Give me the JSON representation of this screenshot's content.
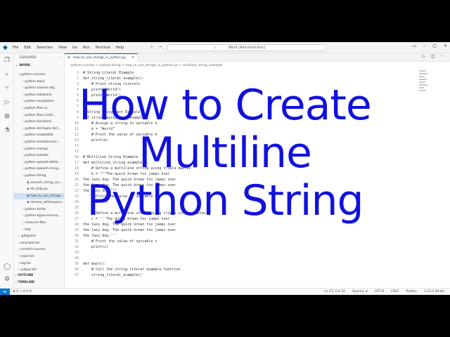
{
  "titlebar": {
    "menu": [
      "File",
      "Edit",
      "Selection",
      "View",
      "Go",
      "Run",
      "Terminal",
      "Help"
    ],
    "search_placeholder": "Work [Administrator]"
  },
  "sidebar": {
    "header": "EXPLORER",
    "section_work": "WORK",
    "tree": [
      {
        "label": "python-courses",
        "indent": 1
      },
      {
        "label": "python-basic",
        "indent": 2
      },
      {
        "label": "python-classes-obj...",
        "indent": 2
      },
      {
        "label": "python-database",
        "indent": 2
      },
      {
        "label": "python-exceptions",
        "indent": 2
      },
      {
        "label": "python-files-io",
        "indent": 2
      },
      {
        "label": "python-flow-contr...",
        "indent": 2
      },
      {
        "label": "python-functions",
        "indent": 2
      },
      {
        "label": "python-list-tuple-dict...",
        "indent": 2
      },
      {
        "label": "python-matplotlib",
        "indent": 2
      },
      {
        "label": "python-modules-pac...",
        "indent": 2
      },
      {
        "label": "python-numpy",
        "indent": 2
      },
      {
        "label": "python-pandas",
        "indent": 2
      },
      {
        "label": "python-special-attrib...",
        "indent": 2
      },
      {
        "label": "python-speech-recog...",
        "indent": 2
      },
      {
        "label": "python-string",
        "indent": 2
      },
      {
        "label": "convert_string_csv...",
        "indent": 3
      },
      {
        "label": "dir_help.py",
        "indent": 3
      },
      {
        "label": "how_to_use_strings...",
        "indent": 3
      },
      {
        "label": "remove_whitespace...",
        "indent": 3
      },
      {
        "label": "python-turtle",
        "indent": 2
      },
      {
        "label": "python-typos-and-op...",
        "indent": 2
      },
      {
        "label": "resource-files",
        "indent": 2
      },
      {
        "label": "test",
        "indent": 2
      },
      {
        "label": ".gitignore",
        "indent": 1
      },
      {
        "label": "example.txt",
        "indent": 1
      },
      {
        "label": "scratch-courses",
        "indent": 1
      },
      {
        "label": "input.txt",
        "indent": 1
      },
      {
        "label": "log.txt",
        "indent": 1
      },
      {
        "label": "output.txt",
        "indent": 1
      }
    ],
    "selected_index": 18,
    "section_outline": "OUTLINE",
    "section_timeline": "TIMELINE"
  },
  "editor": {
    "tab_label": "how_to_use_strings_in_python.py",
    "breadcrumb": "python-courses > python-string > how_to_use_strings_in_python.py > multiline_string_example",
    "code": [
      {
        "n": "1",
        "text": "# String Literal Example"
      },
      {
        "n": "2",
        "text": "def string_literal_example():"
      },
      {
        "n": "3",
        "text": "    # Print string literals"
      },
      {
        "n": "4",
        "text": "    print(\"World\")"
      },
      {
        "n": "5",
        "text": "    print('World')"
      },
      {
        "n": "6",
        "text": ""
      },
      {
        "n": "7",
        "text": ""
      },
      {
        "n": "8",
        "text": "# String Assignment Example"
      },
      {
        "n": "9",
        "text": "def string_assignment_example():"
      },
      {
        "n": "10",
        "text": "    # Assign a string to variable b"
      },
      {
        "n": "11",
        "text": "    b = \"World\""
      },
      {
        "n": "12",
        "text": "    # Print the value of variable b"
      },
      {
        "n": "13",
        "text": "    print(b)"
      },
      {
        "n": "14",
        "text": ""
      },
      {
        "n": "15",
        "text": ""
      },
      {
        "n": "16",
        "text": "# Multiline String Example"
      },
      {
        "n": "17",
        "text": "def multiline_string_example():"
      },
      {
        "n": "18",
        "text": "    # Define a multiline string using triple quotes"
      },
      {
        "n": "19",
        "text": "    b = \"\"\"The quick brown fox jumps over"
      },
      {
        "n": "20",
        "text": "the lazy dog. The quick brown fox jumps over"
      },
      {
        "n": "21",
        "text": "the lazy dog. The quick brown fox jumps over"
      },
      {
        "n": "22",
        "text": "the lazy dog.\"\"\""
      },
      {
        "n": "23",
        "text": "    # Print the value of variable b"
      },
      {
        "n": "24",
        "text": "    print(b)"
      },
      {
        "n": "25",
        "text": ""
      },
      {
        "n": "26",
        "text": "    # Define a multiline string using triple single quotes"
      },
      {
        "n": "27",
        "text": "    c = '''The quick brown fox jumps over"
      },
      {
        "n": "28",
        "text": "the lazy dog. The quick brown fox jumps over"
      },
      {
        "n": "29",
        "text": "the lazy dog. The quick brown fox jumps over"
      },
      {
        "n": "30",
        "text": "the lazy dog.'''"
      },
      {
        "n": "31",
        "text": "    # Print the value of variable c"
      },
      {
        "n": "32",
        "text": "    print(c)"
      },
      {
        "n": "33",
        "text": ""
      },
      {
        "n": "34",
        "text": ""
      },
      {
        "n": "35",
        "text": "def main():"
      },
      {
        "n": "36",
        "text": "    # Call the string literal example function"
      },
      {
        "n": "37",
        "text": "    string_literal_example()"
      }
    ]
  },
  "statusbar": {
    "left": "⊗ 0 ⚠ 0   ⚲ 0",
    "position": "Ln 27, Col 42",
    "spaces": "Spaces: 4",
    "encoding": "UTF-8",
    "eol": "CRLF",
    "language": "Python",
    "interpreter": "3.12.2 64-bit"
  },
  "overlay": {
    "line1": "How to Create",
    "line2": "Multiline",
    "line3": "Python String"
  },
  "colors": {
    "overlay_text": "#1111dd",
    "accent": "#0078d4",
    "selection": "#cce2f7"
  }
}
